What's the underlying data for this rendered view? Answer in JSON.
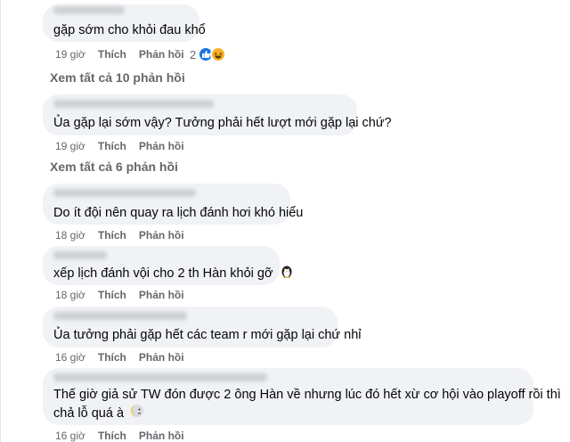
{
  "comments": [
    {
      "text": "gặp sớm cho khỏi đau khổ",
      "time": "19 giờ",
      "like_label": "Thích",
      "reply_label": "Phản hồi",
      "reaction_count": "2"
    },
    {
      "text": "Ủa gặp lại sớm vậy? Tưởng phải hết lượt mới gặp lại chứ?",
      "time": "19 giờ",
      "like_label": "Thích",
      "reply_label": "Phản hồi"
    },
    {
      "text": "Do ít đội nên quay ra lịch đánh hơi khó hiểu",
      "time": "18 giờ",
      "like_label": "Thích",
      "reply_label": "Phản hồi"
    },
    {
      "text": "xếp lịch đánh vội cho 2 th Hàn khỏi gỡ",
      "time": "18 giờ",
      "like_label": "Thích",
      "reply_label": "Phản hồi"
    },
    {
      "text": "Ủa tưởng phải gặp hết các team r mới gặp lại chứ nhỉ",
      "time": "16 giờ",
      "like_label": "Thích",
      "reply_label": "Phản hồi"
    },
    {
      "text_line1": "Thế giờ giả sử TW đón được 2 ông Hàn về nhưng lúc đó hết xừ cơ hội vào playoff rồi thì",
      "text_line2": "chả lỗ quá à",
      "time": "16 giờ",
      "like_label": "Thích",
      "reply_label": "Phản hồi"
    }
  ],
  "view_replies": [
    "Xem tất cả 10 phản hồi",
    "Xem tất cả 6 phản hồi"
  ],
  "icons": {
    "like": "like-icon",
    "haha": "haha-icon",
    "penguin": "penguin-emoji",
    "moon": "moon-emoji"
  },
  "colors": {
    "bubble": "#f0f2f5",
    "meta_text": "#65676b",
    "like_blue": "#1b74e4",
    "haha_yellow": "#f7b125"
  }
}
